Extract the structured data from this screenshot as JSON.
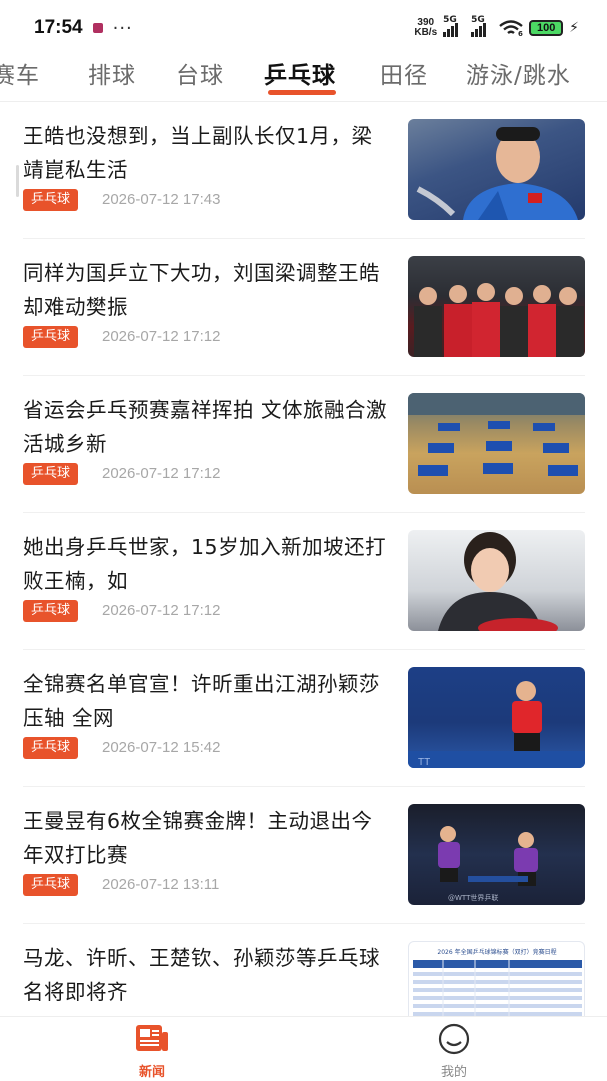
{
  "status_bar": {
    "time": "17:54",
    "net_speed_value": "390",
    "net_speed_unit": "KB/s",
    "signal_label_1": "5G",
    "signal_label_2": "5G",
    "wifi_suffix": "6",
    "battery": "100",
    "notification_icon": "app-notification-icon",
    "overflow_icon": "more-dots-icon"
  },
  "tabs": {
    "items": [
      {
        "label": "赛车"
      },
      {
        "label": "排球"
      },
      {
        "label": "台球"
      },
      {
        "label": "乒乓球"
      },
      {
        "label": "田径"
      },
      {
        "label": "游泳/跳水"
      }
    ],
    "active_index": 3,
    "accent_color": "#e8532b"
  },
  "news": [
    {
      "title": "王皓也没想到，当上副队长仅1月，梁靖崑私生活",
      "tag": "乒乓球",
      "date": "2026-07-12 17:43"
    },
    {
      "title": "同样为国乒立下大功，刘国梁调整王皓却难动樊振",
      "tag": "乒乓球",
      "date": "2026-07-12 17:12"
    },
    {
      "title": "省运会乒乓预赛嘉祥挥拍 文体旅融合激活城乡新",
      "tag": "乒乓球",
      "date": "2026-07-12 17:12"
    },
    {
      "title": "她出身乒乓世家，15岁加入新加坡还打败王楠，如",
      "tag": "乒乓球",
      "date": "2026-07-12 17:12"
    },
    {
      "title": "全锦赛名单官宣！许昕重出江湖孙颖莎压轴 全网",
      "tag": "乒乓球",
      "date": "2026-07-12 15:42"
    },
    {
      "title": "王曼昱有6枚全锦赛金牌！主动退出今年双打比赛",
      "tag": "乒乓球",
      "date": "2026-07-12 13:11"
    },
    {
      "title": "马龙、许昕、王楚钦、孙颖莎等乒乓球名将即将齐",
      "tag": "",
      "date": ""
    }
  ],
  "thumb_captions": {
    "t5_watermark": "TT",
    "t6_watermark": "@WTT世界乒联",
    "t7_header": "2026 年全国乒乓球锦标赛（双打）竞赛日程"
  },
  "bottom_nav": {
    "items": [
      {
        "label": "新闻",
        "icon": "newspaper-icon",
        "active": true
      },
      {
        "label": "我的",
        "icon": "smiley-face-icon",
        "active": false
      }
    ]
  }
}
